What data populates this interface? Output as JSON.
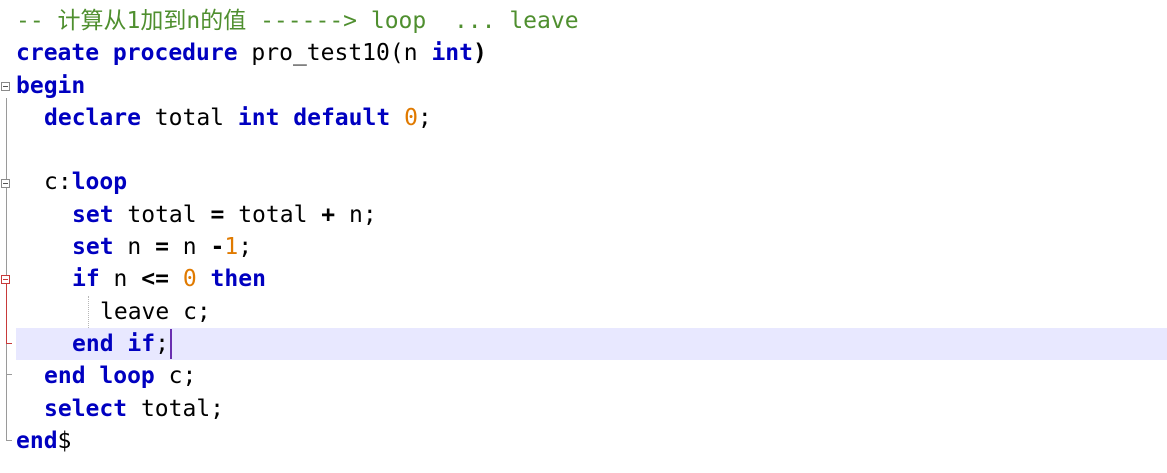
{
  "lines": [
    {
      "comment": "-- 计算从1加到n的值 ------> loop  ... leave"
    },
    {
      "kw1": "create procedure",
      "name": " pro_test10(n ",
      "kw2": "int",
      "close": ")"
    },
    {
      "kw": "begin"
    },
    {
      "kw1": "declare",
      "t1": " total ",
      "kw2": "int default",
      "sp": " ",
      "num": "0",
      "end": ";"
    },
    {
      "text": ""
    },
    {
      "label": "c:",
      "kw": "loop"
    },
    {
      "kw": "set",
      "t1": " total ",
      "op1": "=",
      "t2": " total ",
      "op2": "+",
      "t3": " n;"
    },
    {
      "kw": "set",
      "t1": " n ",
      "op1": "=",
      "t2": " n ",
      "op2": "-",
      "num": "1",
      "end": ";"
    },
    {
      "kw1": "if",
      "t1": " n ",
      "op": "<=",
      "sp": " ",
      "num": "0",
      "sp2": " ",
      "kw2": "then"
    },
    {
      "text": "leave c;"
    },
    {
      "kw": "end if",
      "end": ";"
    },
    {
      "kw": "end loop",
      "t1": " c;"
    },
    {
      "kw": "select",
      "t1": " total;"
    },
    {
      "kw": "end",
      "t1": "$"
    }
  ],
  "colors": {
    "keyword": "#0000c0",
    "comment": "#4f8f2f",
    "number": "#e07a00",
    "current_line": "#e8e8ff",
    "caret": "#6a2fb0"
  },
  "icons": [
    "fold-collapse-icon",
    "fold-guide-line"
  ]
}
